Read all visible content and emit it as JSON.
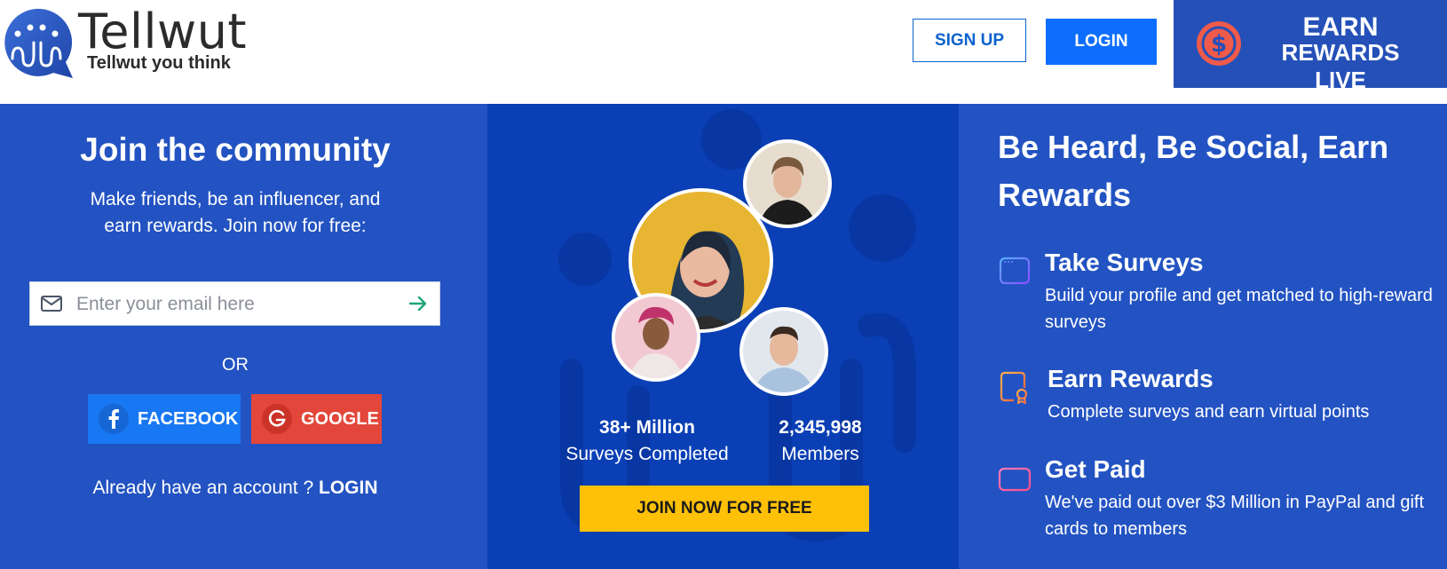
{
  "header": {
    "brand_name": "Tellwut",
    "tagline": "Tellwut you think",
    "signup_label": "SIGN UP",
    "login_label": "LOGIN",
    "earn_line1": "EARN",
    "earn_line2": "REWARDS LIVE",
    "earn_icon": "dollar-coin-icon"
  },
  "join": {
    "title": "Join the community",
    "subtitle": "Make friends, be an influencer, and earn rewards. Join now for free:",
    "email_placeholder": "Enter your email here",
    "email_value": "",
    "or_label": "OR",
    "facebook_label": "FACEBOOK",
    "google_label": "GOOGLE",
    "already_text": "Already have an account ? ",
    "already_login": "LOGIN"
  },
  "stats": {
    "surveys_value": "38+ Million",
    "surveys_label": "Surveys Completed",
    "members_value": "2,345,998",
    "members_label": "Members",
    "join_button": "JOIN NOW FOR FREE"
  },
  "benefits": {
    "title": "Be Heard, Be Social, Earn Rewards",
    "items": [
      {
        "title": "Take Surveys",
        "desc": "Build your profile and get matched to high-reward surveys",
        "icon": "survey-window-icon"
      },
      {
        "title": "Earn Rewards",
        "desc": "Complete surveys and earn virtual points",
        "icon": "certificate-icon"
      },
      {
        "title": "Get Paid",
        "desc": "We've paid out over $3 Million in PayPal and gift cards to members",
        "icon": "credit-card-icon"
      }
    ]
  },
  "colors": {
    "brand_blue": "#0d6efd",
    "panel_blue": "#2353c2",
    "panel_dark_blue": "#0a3fb5",
    "join_yellow": "#ffc107",
    "facebook_blue": "#1877f2",
    "google_red": "#e3463a"
  }
}
